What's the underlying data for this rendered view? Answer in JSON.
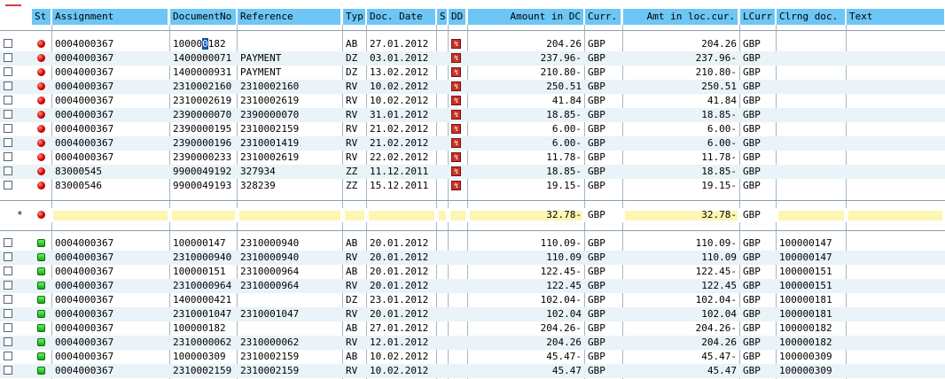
{
  "headers": {
    "st": "St",
    "assignment": "Assignment",
    "document_no": "DocumentNo",
    "reference": "Reference",
    "type": "Typ",
    "doc_date": "Doc. Date",
    "s": "S",
    "dd": "DD",
    "amount_dc": "Amount in DC",
    "curr": "Curr.",
    "amt_loc": "Amt in loc.cur.",
    "lcurr": "LCurr",
    "clrng_doc": "Clrng doc.",
    "text": "Text"
  },
  "open_items": [
    {
      "assignment": "0004000367",
      "document_no": "100000182",
      "reference": "",
      "type": "AB",
      "doc_date": "27.01.2012",
      "amount_dc": "204.26",
      "curr": "GBP",
      "amt_loc": "204.26",
      "lcurr": "GBP",
      "clrng_doc": ""
    },
    {
      "assignment": "0004000367",
      "document_no": "1400000071",
      "reference": "PAYMENT",
      "type": "DZ",
      "doc_date": "03.01.2012",
      "amount_dc": "237.96-",
      "curr": "GBP",
      "amt_loc": "237.96-",
      "lcurr": "GBP",
      "clrng_doc": ""
    },
    {
      "assignment": "0004000367",
      "document_no": "1400000931",
      "reference": "PAYMENT",
      "type": "DZ",
      "doc_date": "13.02.2012",
      "amount_dc": "210.80-",
      "curr": "GBP",
      "amt_loc": "210.80-",
      "lcurr": "GBP",
      "clrng_doc": ""
    },
    {
      "assignment": "0004000367",
      "document_no": "2310002160",
      "reference": "2310002160",
      "type": "RV",
      "doc_date": "10.02.2012",
      "amount_dc": "250.51",
      "curr": "GBP",
      "amt_loc": "250.51",
      "lcurr": "GBP",
      "clrng_doc": ""
    },
    {
      "assignment": "0004000367",
      "document_no": "2310002619",
      "reference": "2310002619",
      "type": "RV",
      "doc_date": "10.02.2012",
      "amount_dc": "41.84",
      "curr": "GBP",
      "amt_loc": "41.84",
      "lcurr": "GBP",
      "clrng_doc": ""
    },
    {
      "assignment": "0004000367",
      "document_no": "2390000070",
      "reference": "2390000070",
      "type": "RV",
      "doc_date": "31.01.2012",
      "amount_dc": "18.85-",
      "curr": "GBP",
      "amt_loc": "18.85-",
      "lcurr": "GBP",
      "clrng_doc": ""
    },
    {
      "assignment": "0004000367",
      "document_no": "2390000195",
      "reference": "2310002159",
      "type": "RV",
      "doc_date": "21.02.2012",
      "amount_dc": "6.00-",
      "curr": "GBP",
      "amt_loc": "6.00-",
      "lcurr": "GBP",
      "clrng_doc": ""
    },
    {
      "assignment": "0004000367",
      "document_no": "2390000196",
      "reference": "2310001419",
      "type": "RV",
      "doc_date": "21.02.2012",
      "amount_dc": "6.00-",
      "curr": "GBP",
      "amt_loc": "6.00-",
      "lcurr": "GBP",
      "clrng_doc": ""
    },
    {
      "assignment": "0004000367",
      "document_no": "2390000233",
      "reference": "2310002619",
      "type": "RV",
      "doc_date": "22.02.2012",
      "amount_dc": "11.78-",
      "curr": "GBP",
      "amt_loc": "11.78-",
      "lcurr": "GBP",
      "clrng_doc": ""
    },
    {
      "assignment": "83000545",
      "document_no": "9900049192",
      "reference": "327934",
      "type": "ZZ",
      "doc_date": "11.12.2011",
      "amount_dc": "18.85-",
      "curr": "GBP",
      "amt_loc": "18.85-",
      "lcurr": "GBP",
      "clrng_doc": ""
    },
    {
      "assignment": "83000546",
      "document_no": "9900049193",
      "reference": "328239",
      "type": "ZZ",
      "doc_date": "15.12.2011",
      "amount_dc": "19.15-",
      "curr": "GBP",
      "amt_loc": "19.15-",
      "lcurr": "GBP",
      "clrng_doc": ""
    }
  ],
  "subtotal": {
    "marker": "*",
    "amount_dc": "32.78-",
    "curr": "GBP",
    "amt_loc": "32.78-",
    "lcurr": "GBP"
  },
  "cleared_items": [
    {
      "assignment": "0004000367",
      "document_no": "100000147",
      "reference": "2310000940",
      "type": "AB",
      "doc_date": "20.01.2012",
      "amount_dc": "110.09-",
      "curr": "GBP",
      "amt_loc": "110.09-",
      "lcurr": "GBP",
      "clrng_doc": "100000147"
    },
    {
      "assignment": "0004000367",
      "document_no": "2310000940",
      "reference": "2310000940",
      "type": "RV",
      "doc_date": "20.01.2012",
      "amount_dc": "110.09",
      "curr": "GBP",
      "amt_loc": "110.09",
      "lcurr": "GBP",
      "clrng_doc": "100000147"
    },
    {
      "assignment": "0004000367",
      "document_no": "100000151",
      "reference": "2310000964",
      "type": "AB",
      "doc_date": "20.01.2012",
      "amount_dc": "122.45-",
      "curr": "GBP",
      "amt_loc": "122.45-",
      "lcurr": "GBP",
      "clrng_doc": "100000151"
    },
    {
      "assignment": "0004000367",
      "document_no": "2310000964",
      "reference": "2310000964",
      "type": "RV",
      "doc_date": "20.01.2012",
      "amount_dc": "122.45",
      "curr": "GBP",
      "amt_loc": "122.45",
      "lcurr": "GBP",
      "clrng_doc": "100000151"
    },
    {
      "assignment": "0004000367",
      "document_no": "1400000421",
      "reference": "",
      "type": "DZ",
      "doc_date": "23.01.2012",
      "amount_dc": "102.04-",
      "curr": "GBP",
      "amt_loc": "102.04-",
      "lcurr": "GBP",
      "clrng_doc": "100000181"
    },
    {
      "assignment": "0004000367",
      "document_no": "2310001047",
      "reference": "2310001047",
      "type": "RV",
      "doc_date": "20.01.2012",
      "amount_dc": "102.04",
      "curr": "GBP",
      "amt_loc": "102.04",
      "lcurr": "GBP",
      "clrng_doc": "100000181"
    },
    {
      "assignment": "0004000367",
      "document_no": "100000182",
      "reference": "",
      "type": "AB",
      "doc_date": "27.01.2012",
      "amount_dc": "204.26-",
      "curr": "GBP",
      "amt_loc": "204.26-",
      "lcurr": "GBP",
      "clrng_doc": "100000182"
    },
    {
      "assignment": "0004000367",
      "document_no": "2310000062",
      "reference": "2310000062",
      "type": "RV",
      "doc_date": "12.01.2012",
      "amount_dc": "204.26",
      "curr": "GBP",
      "amt_loc": "204.26",
      "lcurr": "GBP",
      "clrng_doc": "100000182"
    },
    {
      "assignment": "0004000367",
      "document_no": "100000309",
      "reference": "2310002159",
      "type": "AB",
      "doc_date": "10.02.2012",
      "amount_dc": "45.47-",
      "curr": "GBP",
      "amt_loc": "45.47-",
      "lcurr": "GBP",
      "clrng_doc": "100000309"
    },
    {
      "assignment": "0004000367",
      "document_no": "2310002159",
      "reference": "2310002159",
      "type": "RV",
      "doc_date": "10.02.2012",
      "amount_dc": "45.47",
      "curr": "GBP",
      "amt_loc": "45.47",
      "lcurr": "GBP",
      "clrng_doc": "100000309"
    }
  ]
}
